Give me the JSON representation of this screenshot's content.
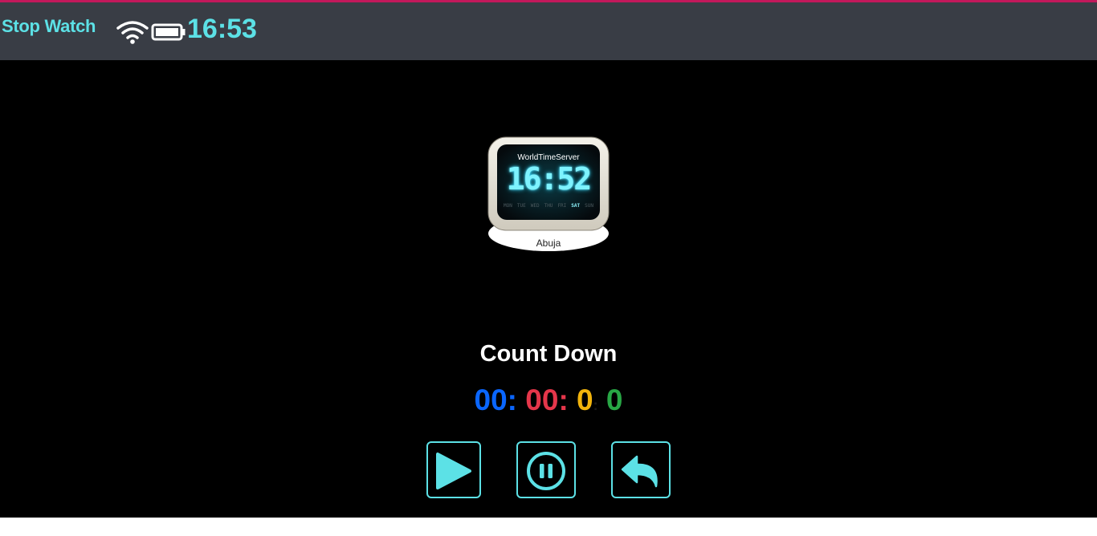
{
  "app": {
    "title": "Stop Watch"
  },
  "status_bar": {
    "time": "16:53",
    "wifi_icon": "wifi-icon",
    "battery_icon": "battery-icon"
  },
  "clock_widget": {
    "brand": "WorldTimeServer",
    "time": "16:52",
    "days": [
      "MON",
      "TUE",
      "WED",
      "THU",
      "FRI",
      "SAT",
      "SUN"
    ],
    "active_day": "SAT",
    "city": "Abuja"
  },
  "countdown": {
    "title": "Count Down",
    "hours": "00",
    "minutes": "00",
    "seconds": "0",
    "milliseconds": "0",
    "separator": ":"
  },
  "controls": {
    "play_icon": "play-icon",
    "pause_icon": "pause-icon",
    "reset_icon": "reset-icon"
  },
  "colors": {
    "accent": "#5ce1e6",
    "topbar": "#393d45",
    "hours": "#0a66ff",
    "minutes": "#e5364a",
    "seconds": "#f2b40c",
    "milliseconds": "#28a745"
  }
}
